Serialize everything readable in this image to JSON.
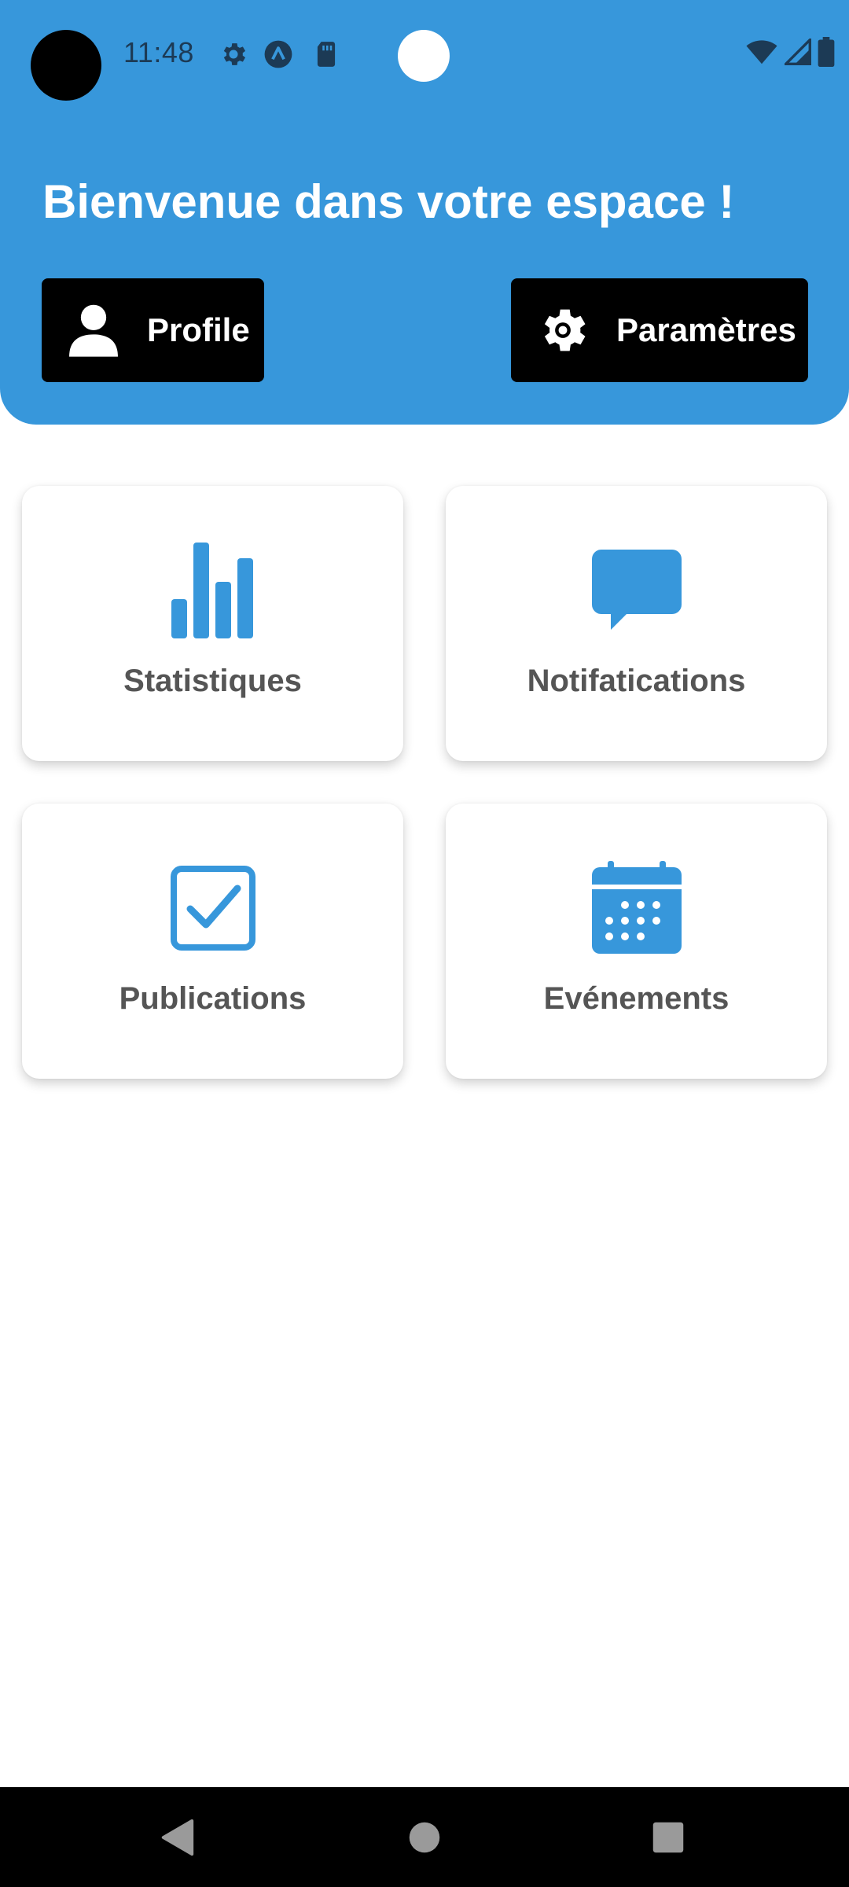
{
  "status_bar": {
    "time": "11:48",
    "left_icons": [
      "settings-icon",
      "app-a-icon",
      "sd-card-icon"
    ],
    "right_icons": [
      "wifi-icon",
      "signal-icon",
      "battery-icon"
    ]
  },
  "header": {
    "title": "Bienvenue dans votre espace !",
    "background_color": "#3797db",
    "buttons": [
      {
        "label": "Profile",
        "icon": "user-icon"
      },
      {
        "label": "Paramètres",
        "icon": "gear-icon"
      }
    ]
  },
  "cards": [
    {
      "label": "Statistiques",
      "icon": "bar-chart-icon"
    },
    {
      "label": "Notifatications",
      "icon": "chat-bubble-icon"
    },
    {
      "label": "Publications",
      "icon": "checkbox-icon"
    },
    {
      "label": "Evénements",
      "icon": "calendar-icon"
    }
  ],
  "accent_color": "#3797db",
  "nav_bar": {
    "buttons": [
      "back-icon",
      "home-icon",
      "recents-icon"
    ]
  }
}
